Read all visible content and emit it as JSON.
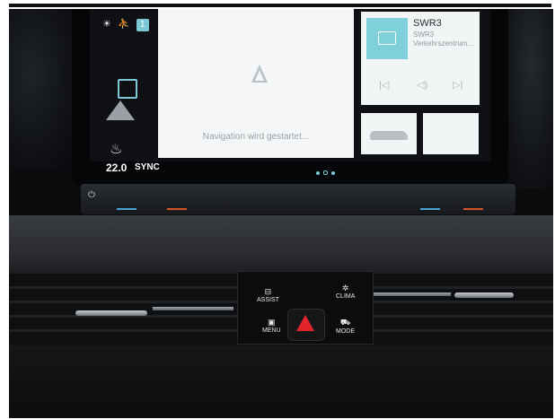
{
  "screen": {
    "status_badge": "1",
    "temperature": "22.0",
    "sync_label": "SYNC",
    "navigation_status": "Navigation wird gestartet...",
    "radio": {
      "title": "SWR3",
      "subtitle": "SWR3",
      "detail": "Verkehrszentrum..."
    }
  },
  "center_console": {
    "assist_label": "ASSIST",
    "clima_label": "CLIMA",
    "menu_label": "MENU",
    "mode_label": "MODE"
  },
  "colors": {
    "accent": "#7cc9d6",
    "hazard": "#e2252b"
  }
}
